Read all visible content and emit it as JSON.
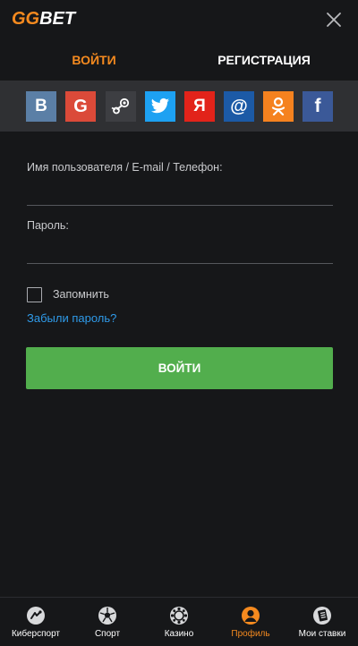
{
  "header": {
    "logo_gg": "GG",
    "logo_bet": "BET",
    "close_icon": "close-icon"
  },
  "tabs": [
    {
      "label": "ВОЙТИ",
      "active": true
    },
    {
      "label": "РЕГИСТРАЦИЯ",
      "active": false
    }
  ],
  "social": [
    {
      "name": "vk",
      "glyph": "B",
      "color": "#5b7fa6"
    },
    {
      "name": "google",
      "glyph": "G",
      "color": "#db4a39"
    },
    {
      "name": "steam",
      "glyph": "",
      "color": "#3d3e42"
    },
    {
      "name": "twitter",
      "glyph": "",
      "color": "#1da1f2"
    },
    {
      "name": "yandex",
      "glyph": "Я",
      "color": "#e2231a"
    },
    {
      "name": "mailru",
      "glyph": "@",
      "color": "#1c5aa6"
    },
    {
      "name": "odnoklassniki",
      "glyph": "",
      "color": "#f5821f"
    },
    {
      "name": "facebook",
      "glyph": "f",
      "color": "#3b5998"
    }
  ],
  "form": {
    "username_label": "Имя пользователя / E-mail / Телефон:",
    "username_value": "",
    "password_label": "Пароль:",
    "password_value": "",
    "remember_label": "Запомнить",
    "remember_checked": false,
    "forgot_label": "Забыли пароль?",
    "submit_label": "ВОЙТИ"
  },
  "colors": {
    "accent": "#f58a1f",
    "link": "#2f9bea",
    "primary_button": "#52ae4d",
    "background": "#161719"
  },
  "bottom_nav": [
    {
      "label": "Киберспорт",
      "icon": "esports-icon",
      "active": false
    },
    {
      "label": "Спорт",
      "icon": "soccer-ball-icon",
      "active": false
    },
    {
      "label": "Казино",
      "icon": "casino-chip-icon",
      "active": false
    },
    {
      "label": "Профиль",
      "icon": "profile-icon",
      "active": true
    },
    {
      "label": "Мои ставки",
      "icon": "bets-icon",
      "active": false
    }
  ]
}
